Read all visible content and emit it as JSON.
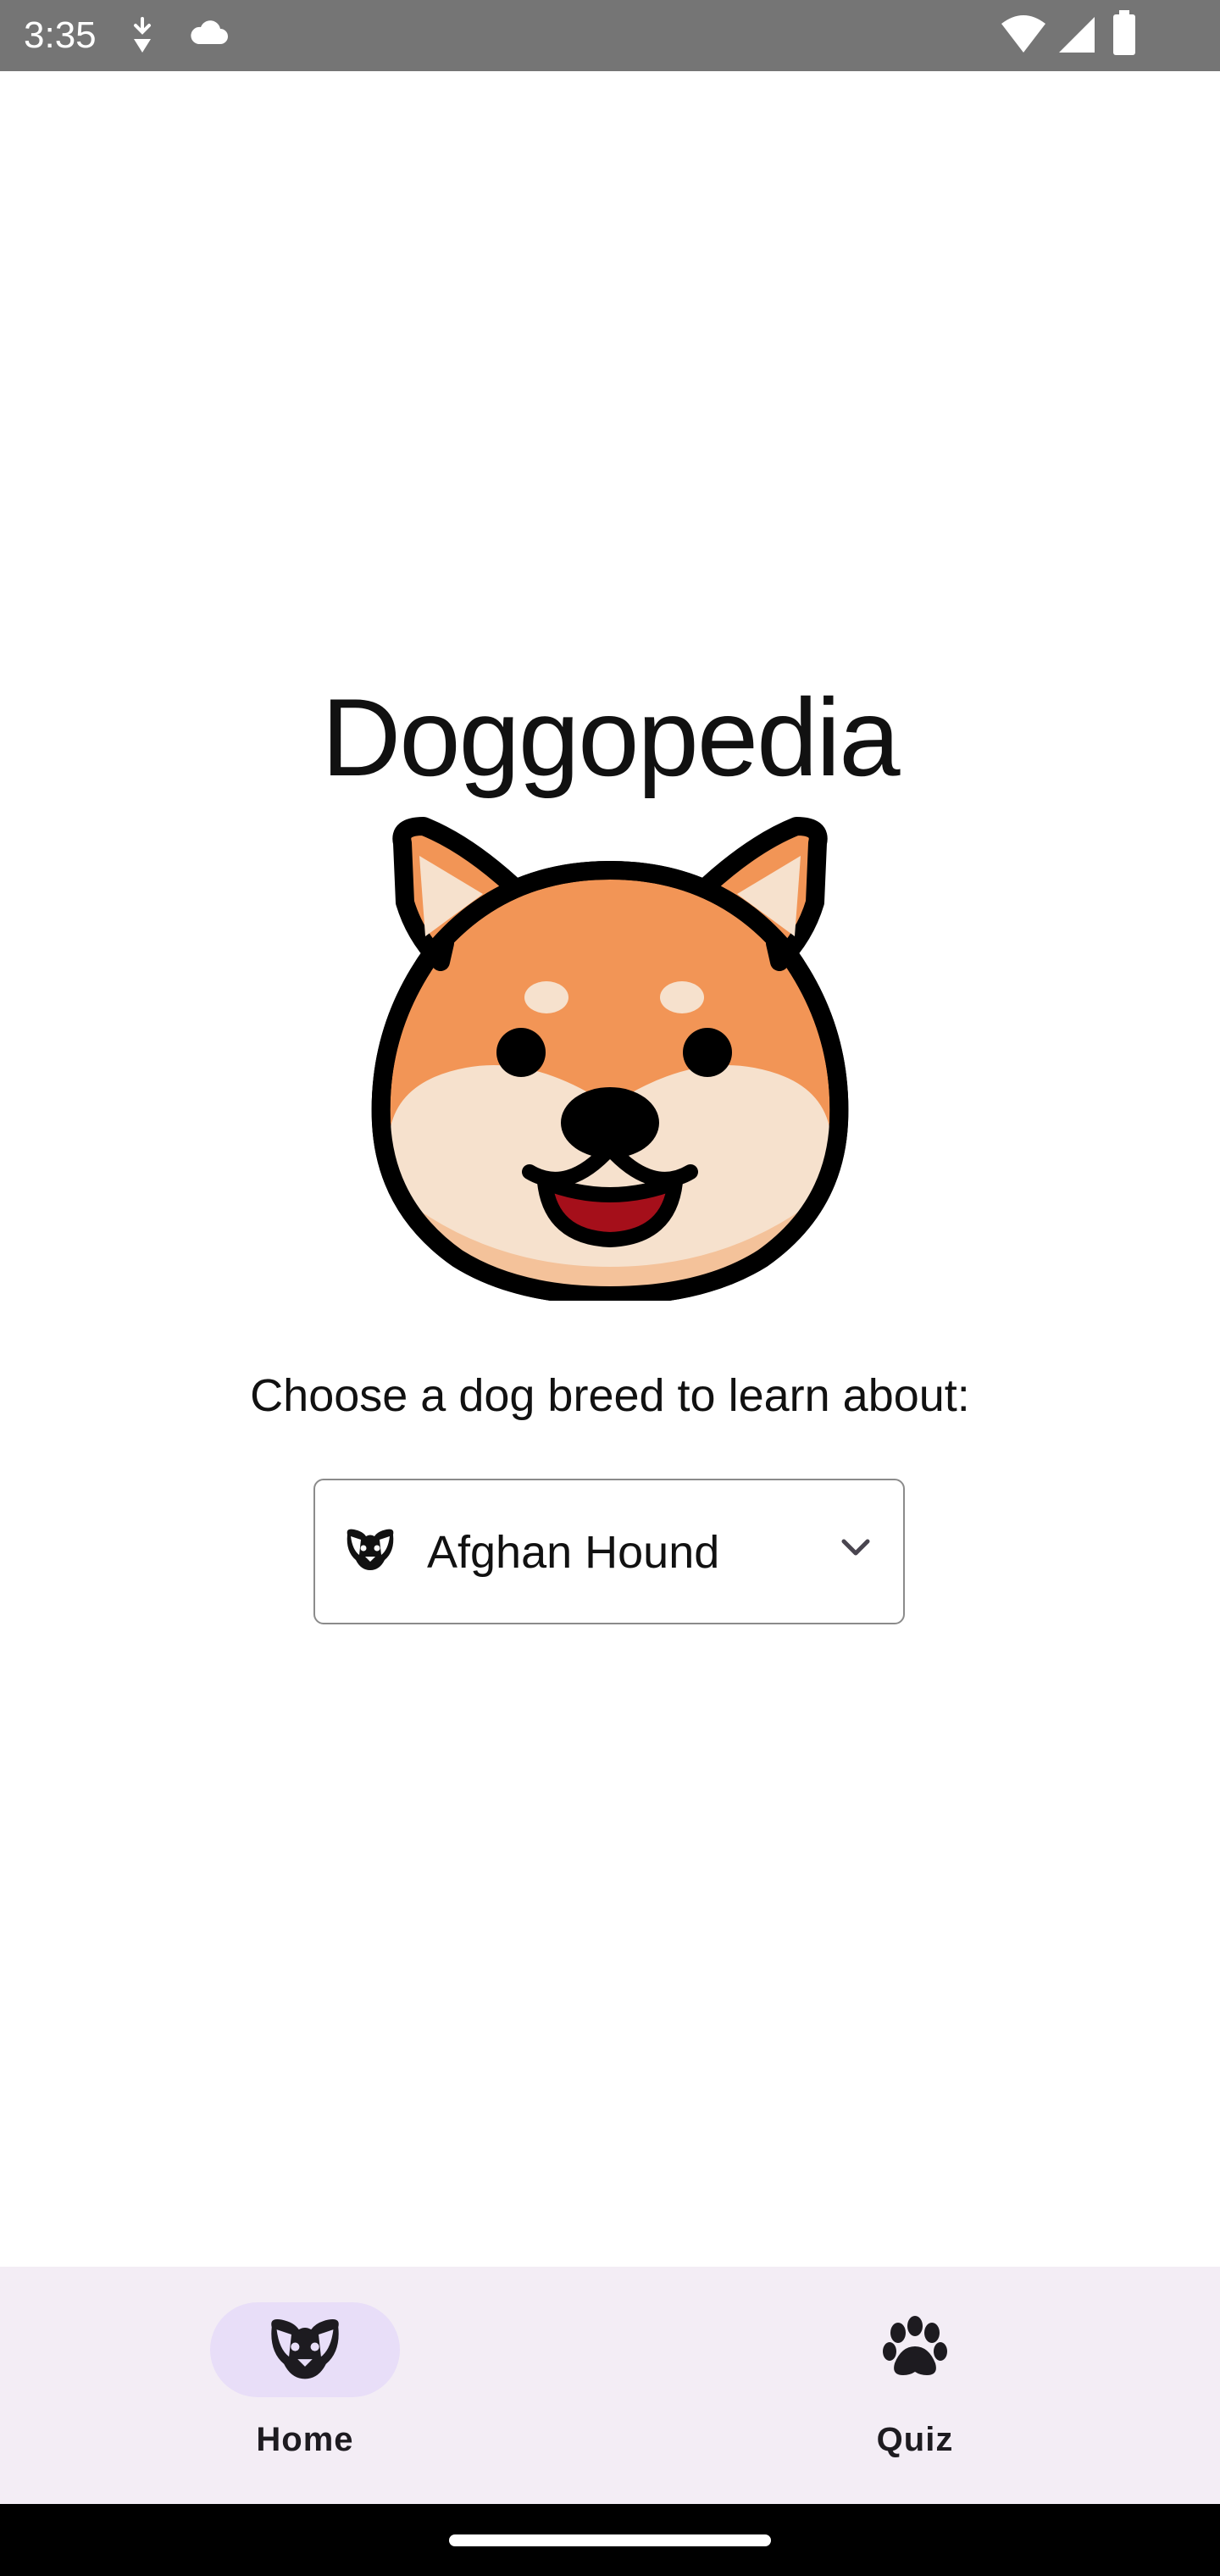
{
  "status_bar": {
    "time": "3:35",
    "left_icons": [
      "data-saver-icon",
      "cloud-icon"
    ],
    "right_icons": [
      "wifi-icon",
      "signal-icon",
      "battery-icon"
    ]
  },
  "app": {
    "title": "Doggopedia",
    "mascot": "shiba-dog-face-icon"
  },
  "main": {
    "prompt": "Choose a dog breed to learn about:",
    "breed_select": {
      "value": "Afghan Hound",
      "icon": "dog-face-icon",
      "dropdown_icon": "chevron-down-icon"
    }
  },
  "bottom_nav": {
    "items": [
      {
        "label": "Home",
        "icon": "dog-face-icon",
        "active": true
      },
      {
        "label": "Quiz",
        "icon": "paw-icon",
        "active": false
      }
    ]
  },
  "colors": {
    "status_bar": "#757575",
    "nav_background": "#f3edf5",
    "nav_active_pill": "#e8def8",
    "dog_orange": "#f29556",
    "dog_cream": "#f6e1cd",
    "dog_tongue": "#a50f1a"
  }
}
